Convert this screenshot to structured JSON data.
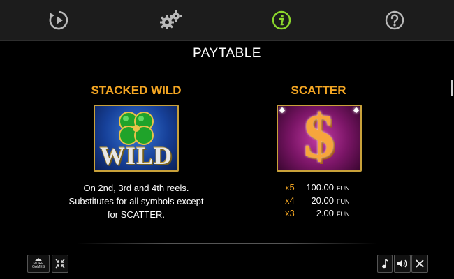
{
  "title": "PAYTABLE",
  "top_nav": [
    {
      "id": "autoplay",
      "icon": "replay-play-icon",
      "active": false
    },
    {
      "id": "settings",
      "icon": "gears-icon",
      "active": false
    },
    {
      "id": "info",
      "icon": "info-icon",
      "active": true
    },
    {
      "id": "help",
      "icon": "question-icon",
      "active": false
    }
  ],
  "colors": {
    "accent": "#f4a623",
    "active_icon": "#8bd62c",
    "icon": "#b9b9b9"
  },
  "wild": {
    "heading": "STACKED WILD",
    "symbol_text": "WILD",
    "description_lines": [
      "On 2nd, 3rd and 4th reels.",
      "Substitutes for all symbols except",
      "for SCATTER."
    ]
  },
  "scatter": {
    "heading": "SCATTER",
    "symbol_text": "$",
    "payouts": [
      {
        "mult": "x5",
        "amount": "100.00",
        "currency": "FUN"
      },
      {
        "mult": "x4",
        "amount": "20.00",
        "currency": "FUN"
      },
      {
        "mult": "x3",
        "amount": "2.00",
        "currency": "FUN"
      }
    ]
  },
  "bottom_left": {
    "more_games_line1": "MORE",
    "more_games_line2": "GAMES"
  },
  "bottom_right": {
    "music_icon": "music-note-icon",
    "sound_icon": "speaker-icon",
    "close_icon": "close-icon"
  }
}
